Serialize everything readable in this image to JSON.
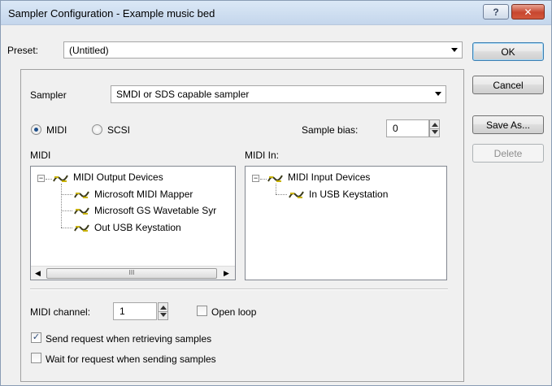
{
  "window": {
    "title": "Sampler Configuration - Example music bed",
    "help_label": "?",
    "close_label": "✕"
  },
  "preset": {
    "label": "Preset:",
    "value": "(Untitled)"
  },
  "buttons": {
    "ok": "OK",
    "cancel": "Cancel",
    "save_as": "Save As...",
    "delete": "Delete"
  },
  "sampler": {
    "label": "Sampler",
    "value": "SMDI or SDS capable sampler"
  },
  "mode": {
    "midi_label": "MIDI",
    "scsi_label": "SCSI",
    "selected": "MIDI"
  },
  "sample_bias": {
    "label": "Sample bias:",
    "value": "0"
  },
  "midi_out": {
    "label": "MIDI",
    "root": "MIDI Output Devices",
    "devices": [
      "Microsoft MIDI Mapper",
      "Microsoft GS Wavetable Syr",
      "Out USB Keystation"
    ],
    "scroll_thumb": "III"
  },
  "midi_in": {
    "label": "MIDI In:",
    "root": "MIDI Input Devices",
    "devices": [
      "In USB Keystation"
    ]
  },
  "midi_channel": {
    "label": "MIDI channel:",
    "value": "1"
  },
  "options": {
    "open_loop": {
      "label": "Open loop",
      "checked": false
    },
    "send_request": {
      "label": "Send request when retrieving samples",
      "checked": true
    },
    "wait_request": {
      "label": "Wait for request when sending samples",
      "checked": false
    }
  },
  "icons": {
    "device": "midi-connector-icon",
    "expand": "minus-expander-icon"
  }
}
